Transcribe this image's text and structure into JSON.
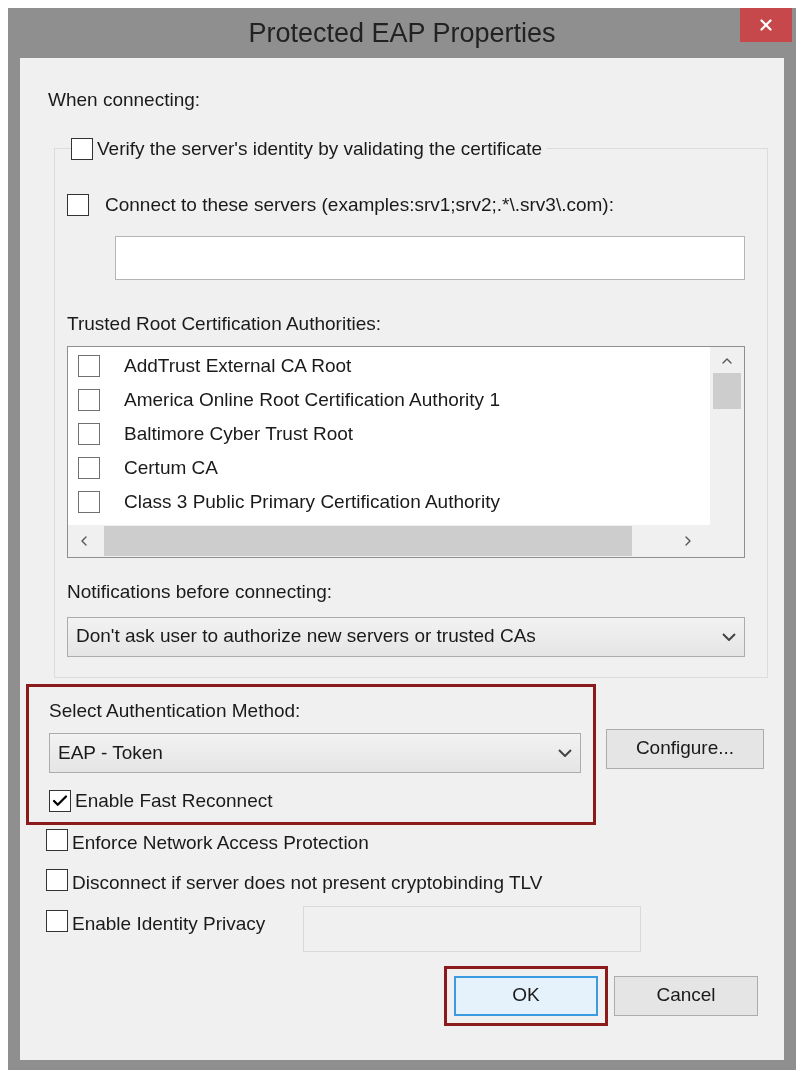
{
  "window": {
    "title": "Protected EAP Properties"
  },
  "when_connecting": {
    "label": "When connecting:",
    "verify": {
      "label": "Verify the server's identity by validating the certificate",
      "checked": false
    },
    "connect_servers": {
      "label": "Connect to these servers (examples:srv1;srv2;.*\\.srv3\\.com):",
      "checked": false
    },
    "trusted_roots": {
      "label": "Trusted Root Certification Authorities:",
      "items": [
        {
          "label": "AddTrust External CA Root",
          "checked": false
        },
        {
          "label": "America Online Root Certification Authority 1",
          "checked": false
        },
        {
          "label": "Baltimore Cyber Trust Root",
          "checked": false
        },
        {
          "label": "Certum CA",
          "checked": false
        },
        {
          "label": "Class 3 Public Primary Certification Authority",
          "checked": false
        }
      ]
    },
    "notifications": {
      "label": "Notifications before connecting:",
      "value": "Don't ask user to authorize new servers or trusted CAs"
    }
  },
  "auth": {
    "label": "Select Authentication Method:",
    "value": "EAP - Token",
    "highlighted": true,
    "configure": "Configure...",
    "fast_reconnect": {
      "label": "Enable Fast Reconnect",
      "checked": true
    }
  },
  "options": [
    {
      "label": "Enforce Network Access Protection",
      "checked": false
    },
    {
      "label": "Disconnect if server does not present cryptobinding TLV",
      "checked": false
    },
    {
      "label": "Enable Identity Privacy",
      "checked": false,
      "kind": "with_field"
    }
  ],
  "buttons": [
    {
      "label": "OK",
      "default": true,
      "highlighted": true
    },
    {
      "label": "Cancel",
      "default": false,
      "highlighted": false
    }
  ]
}
